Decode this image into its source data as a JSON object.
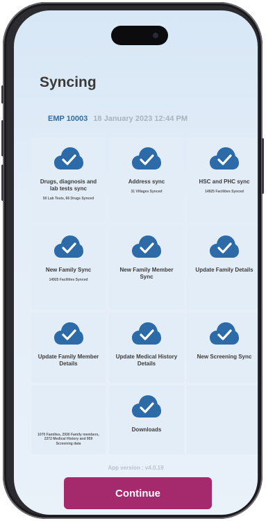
{
  "header": {
    "title": "Syncing",
    "emp_id": "EMP 10003",
    "datetime": "18 January 2023 12:44 PM"
  },
  "tiles": [
    {
      "label": "Drugs, diagnosis and lab tests sync",
      "sub": "50 Lab Tests, 66 Drugs Synced"
    },
    {
      "label": "Address sync",
      "sub": "31 Villages Synced"
    },
    {
      "label": "HSC and PHC sync",
      "sub": "14925 Facilities Synced"
    },
    {
      "label": "New Family Sync",
      "sub": "14925 Facilities Synced"
    },
    {
      "label": "New Family Member Sync",
      "sub": ""
    },
    {
      "label": "Update Family Details",
      "sub": ""
    },
    {
      "label": "Update Family Member Details",
      "sub": ""
    },
    {
      "label": "Update Medical History Details",
      "sub": ""
    },
    {
      "label": "New Screening Sync",
      "sub": ""
    },
    {
      "label": "",
      "sub": "1070 Families, 2930 Family members, 2372 Medical History and 959 Screening data"
    },
    {
      "label": "Downloads",
      "sub": ""
    }
  ],
  "footer": {
    "version": "App version : v4.0.19",
    "continue_label": "Continue"
  },
  "colors": {
    "accent": "#a52a6d",
    "cloud": "#2c6aa8",
    "emp": "#2f6da3"
  },
  "icons": {
    "tile_icon": "cloud-check-icon"
  }
}
